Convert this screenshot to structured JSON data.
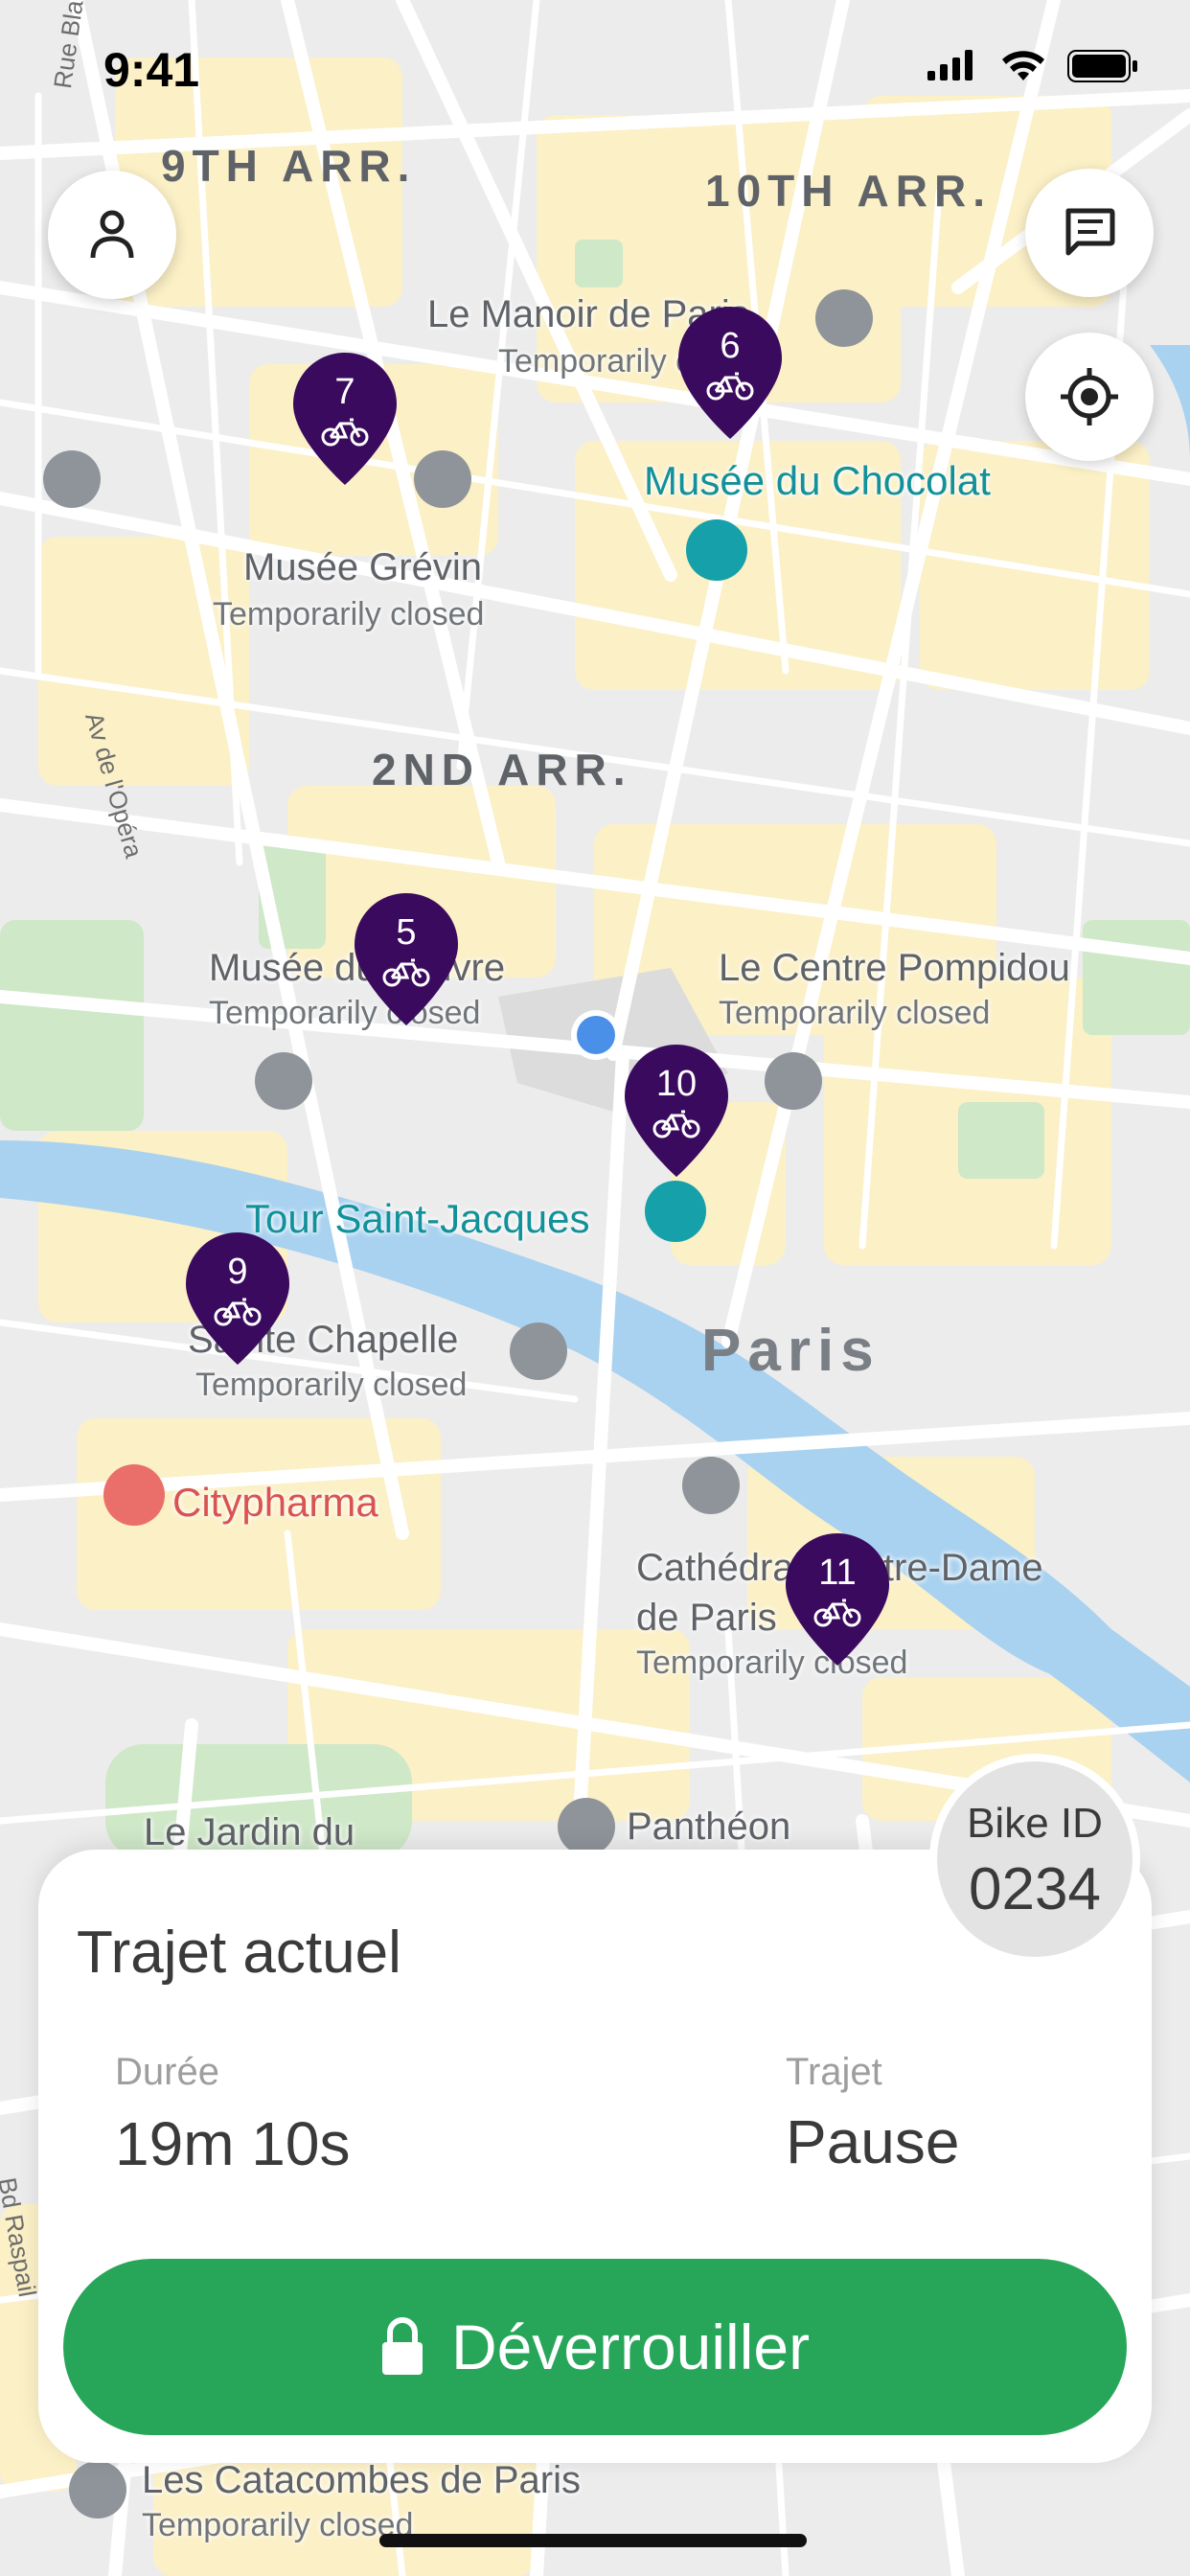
{
  "status_bar": {
    "time": "9:41"
  },
  "map": {
    "districts": [
      "9TH ARR.",
      "10TH ARR.",
      "2ND ARR."
    ],
    "streets": [
      "Rue Blanche",
      "Av de l'Opéra",
      "Bd Raspail"
    ],
    "places": [
      {
        "name": "Le Manoir de Paris",
        "note": "Temporarily closed"
      },
      {
        "name": "Musée du Chocolat"
      },
      {
        "name": "Musée Grévin",
        "note": "Temporarily closed"
      },
      {
        "name": "Musée du Louvre",
        "note": "Temporarily closed"
      },
      {
        "name": "Le Centre Pompidou",
        "note": "Temporarily closed"
      },
      {
        "name": "Tour Saint-Jacques"
      },
      {
        "name": "Sainte Chapelle",
        "note": "Temporarily closed"
      },
      {
        "name": "Citypharma"
      },
      {
        "name": "Cathédrale Notre-Dame de Paris",
        "note": "Temporarily closed"
      },
      {
        "name": "Le Jardin du"
      },
      {
        "name": "Panthéon"
      },
      {
        "name": "Les Catacombes de Paris",
        "note": "Temporarily closed"
      },
      {
        "name": "Paris"
      }
    ],
    "markers": [
      "7",
      "6",
      "5",
      "10",
      "9",
      "11"
    ],
    "marker_color": "#3a0a5e",
    "user_location_color": "#4a8fe8"
  },
  "trip": {
    "title": "Trajet actuel",
    "duration_label": "Durée",
    "duration_value": "19m 10s",
    "trip_label": "Trajet",
    "trip_value": "Pause"
  },
  "bike": {
    "id_label": "Bike ID",
    "id_value": "0234"
  },
  "unlock_button": {
    "label": "Déverrouiller",
    "color": "#27a65a"
  },
  "icons": [
    "profile-icon",
    "chat-icon",
    "locate-icon",
    "lock-icon",
    "bike-icon"
  ]
}
